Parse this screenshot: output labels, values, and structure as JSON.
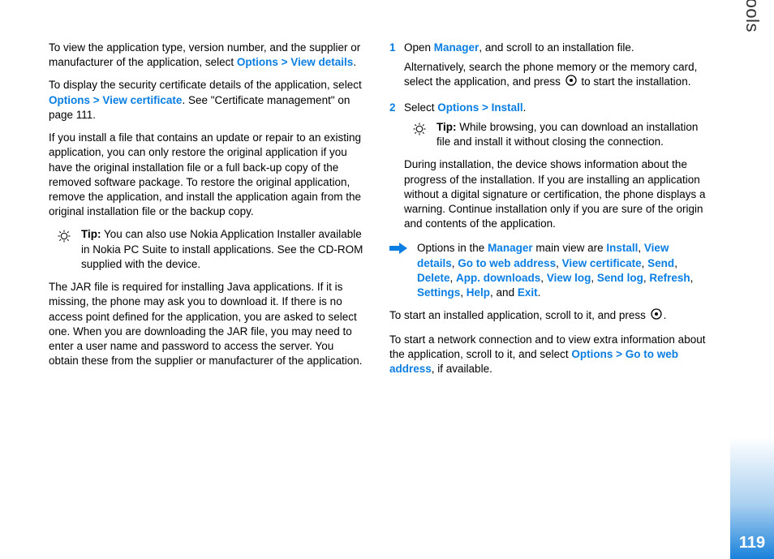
{
  "side_title": "Tools",
  "page_number": "119",
  "left_col": {
    "p1_a": "To view the application type, version number, and the supplier or manufacturer of the application, select ",
    "p1_link": "Options > View details",
    "p1_b": ".",
    "p2_a": "To display the security certificate details of the application, select ",
    "p2_link": "Options > View certificate",
    "p2_b": ". See \"Certificate management\" on page 111.",
    "p3": "If you install a file that contains an update or repair to an existing application, you can only restore the original application if you have the original installation file or a full back-up copy of the removed software package. To restore the original application, remove the application, and install the application again from the original installation file or the backup copy.",
    "tip1_label": "Tip:",
    "tip1_body": " You can also use Nokia Application Installer available in Nokia PC Suite to install applications. See the CD-ROM supplied with the device.",
    "p4": "The JAR file is required for installing Java applications. If it is missing, the phone may ask you to download it. If there is no access point defined for the application, you are asked to select one. When you are downloading the JAR file, you may need to enter a user name and password to access the server. You obtain these from the supplier or manufacturer of the application."
  },
  "right_col": {
    "step1_num": "1",
    "step1_a": "Open ",
    "step1_link": "Manager",
    "step1_b": ", and scroll to an installation file.",
    "step1_p2_a": "Alternatively, search the phone memory or the memory card, select the application, and press ",
    "step1_p2_b": " to start the installation.",
    "step2_num": "2",
    "step2_a": "Select ",
    "step2_link": "Options > Install",
    "step2_b": ".",
    "tip2_label": "Tip:",
    "tip2_body": "  While browsing, you can download an installation file and install it without closing the connection.",
    "p_during": "During installation, the device shows information about the progress of the installation. If you are installing an application without a digital signature or certification, the phone displays a warning. Continue installation only if you are sure of the origin and contents of the application.",
    "opt_a": "Options in the ",
    "opt_manager": "Manager",
    "opt_b": " main view are ",
    "opt_install": "Install",
    "opt_view_details": "View details",
    "opt_goto": "Go to web address",
    "opt_view_cert": "View certificate",
    "opt_send": "Send",
    "opt_delete": "Delete",
    "opt_app_dl": "App. downloads",
    "opt_view_log": "View log",
    "opt_send_log": "Send log",
    "opt_refresh": "Refresh",
    "opt_settings": "Settings",
    "opt_help": "Help",
    "opt_and": ", and ",
    "opt_exit": "Exit",
    "opt_period": ".",
    "p_start_a": "To start an installed application, scroll to it, and press ",
    "p_start_b": ".",
    "p_net_a": "To start a network connection and to view extra information about the application, scroll to it, and select ",
    "p_net_link": "Options > Go to web address",
    "p_net_b": ", if available."
  }
}
